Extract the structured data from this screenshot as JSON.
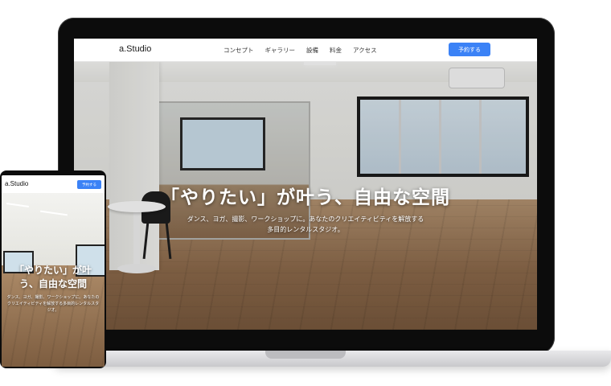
{
  "desktop": {
    "brand": "a.Studio",
    "nav": [
      "コンセプト",
      "ギャラリー",
      "設備",
      "料金",
      "アクセス"
    ],
    "cta": "予約する",
    "hero_title": "「やりたい」が叶う、自由な空間",
    "hero_subtitle": "ダンス、ヨガ、撮影、ワークショップに。あなたのクリエイティビティを解放する多目的レンタルスタジオ。"
  },
  "mobile": {
    "brand": "a.Studio",
    "cta": "予約する",
    "hero_title": "「やりたい」が叶う、自由な空間",
    "hero_subtitle": "ダンス、ヨガ、撮影、ワークショップに。あなたのクリエイティビティを解放する多目的レンタルスタジオ。"
  },
  "colors": {
    "accent": "#3b82f6",
    "device_frame": "#0c0c0c"
  }
}
